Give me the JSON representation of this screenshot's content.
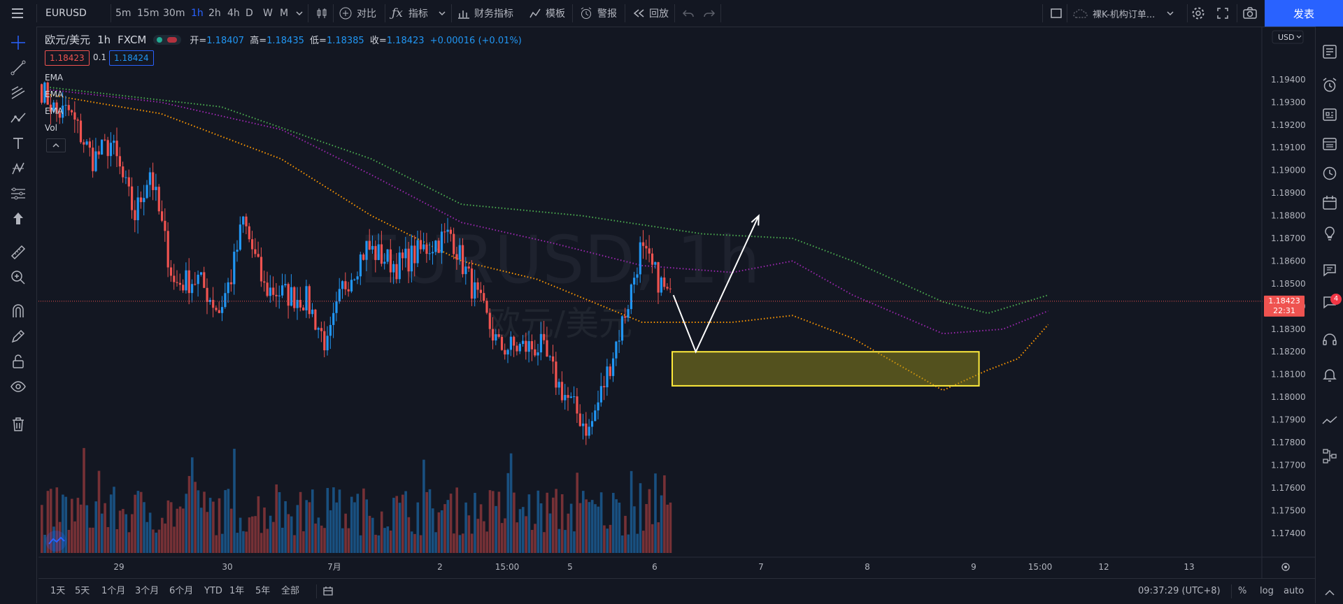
{
  "symbol": "EURUSD",
  "toolbar": {
    "timeframes": [
      "5m",
      "15m",
      "30m",
      "1h",
      "2h",
      "4h",
      "D",
      "W",
      "M"
    ],
    "active_timeframe": "1h",
    "compare": "对比",
    "indicators": "指标",
    "financials": "财务指标",
    "templates": "模板",
    "alerts": "警报",
    "replay": "回放",
    "layout_name": "裸K-机构订单...",
    "publish": "发表"
  },
  "legend": {
    "pair": "欧元/美元",
    "interval": "1h",
    "exchange": "FXCM",
    "open_label": "开",
    "open": "1.18407",
    "high_label": "高",
    "high": "1.18435",
    "low_label": "低",
    "low": "1.18385",
    "close_label": "收",
    "close": "1.18423",
    "change": "+0.00016 (+0.01%)"
  },
  "price_boxes": {
    "bid": "1.18423",
    "spread": "0.1",
    "ask": "1.18424"
  },
  "indicators": [
    "EMA",
    "EMA",
    "EMA",
    "Vol"
  ],
  "watermark": {
    "symbol": "EURUSD, 1h",
    "name": "欧元/美元"
  },
  "price_axis": {
    "currency": "USD",
    "labels": [
      "1.19400",
      "1.19300",
      "1.19200",
      "1.19100",
      "1.19000",
      "1.18900",
      "1.18800",
      "1.18700",
      "1.18600",
      "1.18500",
      "1.18400",
      "1.18300",
      "1.18200",
      "1.18100",
      "1.18000",
      "1.17900",
      "1.17800",
      "1.17700",
      "1.17600",
      "1.17500",
      "1.17400"
    ],
    "current_price": "1.18423",
    "countdown": "22:31"
  },
  "time_axis": [
    "29",
    "30",
    "7月",
    "2",
    "15:00",
    "5",
    "6",
    "7",
    "8",
    "9",
    "15:00",
    "12",
    "13"
  ],
  "bottom": {
    "ranges": [
      "1天",
      "5天",
      "1个月",
      "3个月",
      "6个月",
      "YTD",
      "1年",
      "5年",
      "全部"
    ],
    "clock": "09:37:29 (UTC+8)",
    "percent": "%",
    "log": "log",
    "auto": "auto"
  },
  "notification_count": "4",
  "colors": {
    "bg": "#131722",
    "up": "#2196f3",
    "down": "#ef5350",
    "ema_fast": "#ff9800",
    "ema_mid": "#9c27b0",
    "ema_slow": "#4caf50",
    "zone": "#ffeb3b",
    "accent": "#2962ff"
  },
  "chart_data": {
    "type": "candlestick",
    "interval": "1h",
    "ylim": [
      1.1735,
      1.196
    ],
    "segments": [
      [
        1.1938,
        1.1925,
        6
      ],
      [
        1.1925,
        1.1926,
        4
      ],
      [
        1.1926,
        1.1905,
        8
      ],
      [
        1.1905,
        1.1912,
        6
      ],
      [
        1.1912,
        1.188,
        8
      ],
      [
        1.188,
        1.19,
        5
      ],
      [
        1.19,
        1.185,
        8
      ],
      [
        1.185,
        1.1852,
        8
      ],
      [
        1.1852,
        1.1838,
        7
      ],
      [
        1.1838,
        1.1853,
        4
      ],
      [
        1.1853,
        1.1878,
        4
      ],
      [
        1.1878,
        1.1848,
        7
      ],
      [
        1.1848,
        1.1845,
        8
      ],
      [
        1.1845,
        1.1843,
        6
      ],
      [
        1.1843,
        1.1822,
        7
      ],
      [
        1.1822,
        1.1848,
        5
      ],
      [
        1.1848,
        1.1866,
        8
      ],
      [
        1.1866,
        1.1858,
        10
      ],
      [
        1.1858,
        1.1866,
        10
      ],
      [
        1.1866,
        1.1872,
        8
      ],
      [
        1.1872,
        1.1852,
        6
      ],
      [
        1.1852,
        1.1822,
        10
      ],
      [
        1.1822,
        1.1822,
        14
      ],
      [
        1.1822,
        1.1805,
        6
      ],
      [
        1.1805,
        1.1785,
        10
      ],
      [
        1.1785,
        1.1806,
        5
      ],
      [
        1.1806,
        1.1842,
        8
      ],
      [
        1.1842,
        1.1865,
        4
      ],
      [
        1.1865,
        1.1843,
        10
      ]
    ],
    "ema_fast": [
      [
        0,
        1.1934
      ],
      [
        40,
        1.1925
      ],
      [
        80,
        1.1905
      ],
      [
        110,
        1.188
      ],
      [
        140,
        1.186
      ],
      [
        165,
        1.1852
      ],
      [
        200,
        1.1833
      ],
      [
        230,
        1.1833
      ],
      [
        250,
        1.1836
      ],
      [
        270,
        1.1826
      ],
      [
        300,
        1.1803
      ],
      [
        315,
        1.1812
      ],
      [
        325,
        1.1817
      ],
      [
        335,
        1.1832
      ]
    ],
    "ema_mid": [
      [
        0,
        1.1936
      ],
      [
        40,
        1.193
      ],
      [
        80,
        1.1918
      ],
      [
        110,
        1.1898
      ],
      [
        140,
        1.1877
      ],
      [
        170,
        1.1868
      ],
      [
        200,
        1.1858
      ],
      [
        230,
        1.1855
      ],
      [
        250,
        1.186
      ],
      [
        270,
        1.1845
      ],
      [
        300,
        1.1828
      ],
      [
        320,
        1.183
      ],
      [
        335,
        1.1838
      ]
    ],
    "ema_slow": [
      [
        0,
        1.1937
      ],
      [
        60,
        1.1928
      ],
      [
        110,
        1.1905
      ],
      [
        140,
        1.1885
      ],
      [
        180,
        1.188
      ],
      [
        220,
        1.1872
      ],
      [
        250,
        1.187
      ],
      [
        270,
        1.186
      ],
      [
        300,
        1.1842
      ],
      [
        315,
        1.1837
      ],
      [
        335,
        1.1845
      ]
    ],
    "zone": {
      "price_top": 1.182,
      "price_bottom": 1.1805
    },
    "projection": [
      [
        1.1845
      ],
      [
        1.182
      ],
      [
        1.188
      ]
    ]
  }
}
